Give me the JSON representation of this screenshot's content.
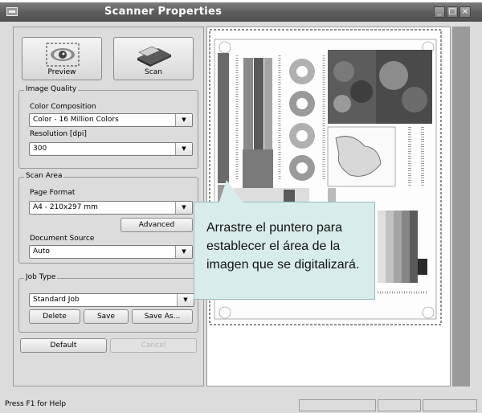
{
  "window": {
    "title": "Scanner Properties"
  },
  "buttons": {
    "preview": "Preview",
    "scan": "Scan"
  },
  "image_quality": {
    "legend": "Image Quality",
    "color_label": "Color Composition",
    "color_value": "Color - 16 Million Colors",
    "res_label": "Resolution [dpi]",
    "res_value": "300"
  },
  "scan_area": {
    "legend": "Scan Area",
    "page_label": "Page Format",
    "page_value": "A4 - 210x297 mm",
    "advanced": "Advanced",
    "source_label": "Document Source",
    "source_value": "Auto"
  },
  "job_type": {
    "legend": "Job Type",
    "value": "Standard Job",
    "delete": "Delete",
    "save": "Save",
    "save_as": "Save As..."
  },
  "bottom": {
    "default": "Default",
    "cancel": "Cancel"
  },
  "status": {
    "text": "Press F1 for Help"
  },
  "callout": {
    "text": "Arrastre el puntero para establecer el área de la imagen que se digitalizará."
  },
  "icons": [
    "app-icon",
    "minimize-icon",
    "maximize-icon",
    "close-icon",
    "eye-preview-icon",
    "scanner-icon",
    "dropdown-arrow-icon"
  ]
}
